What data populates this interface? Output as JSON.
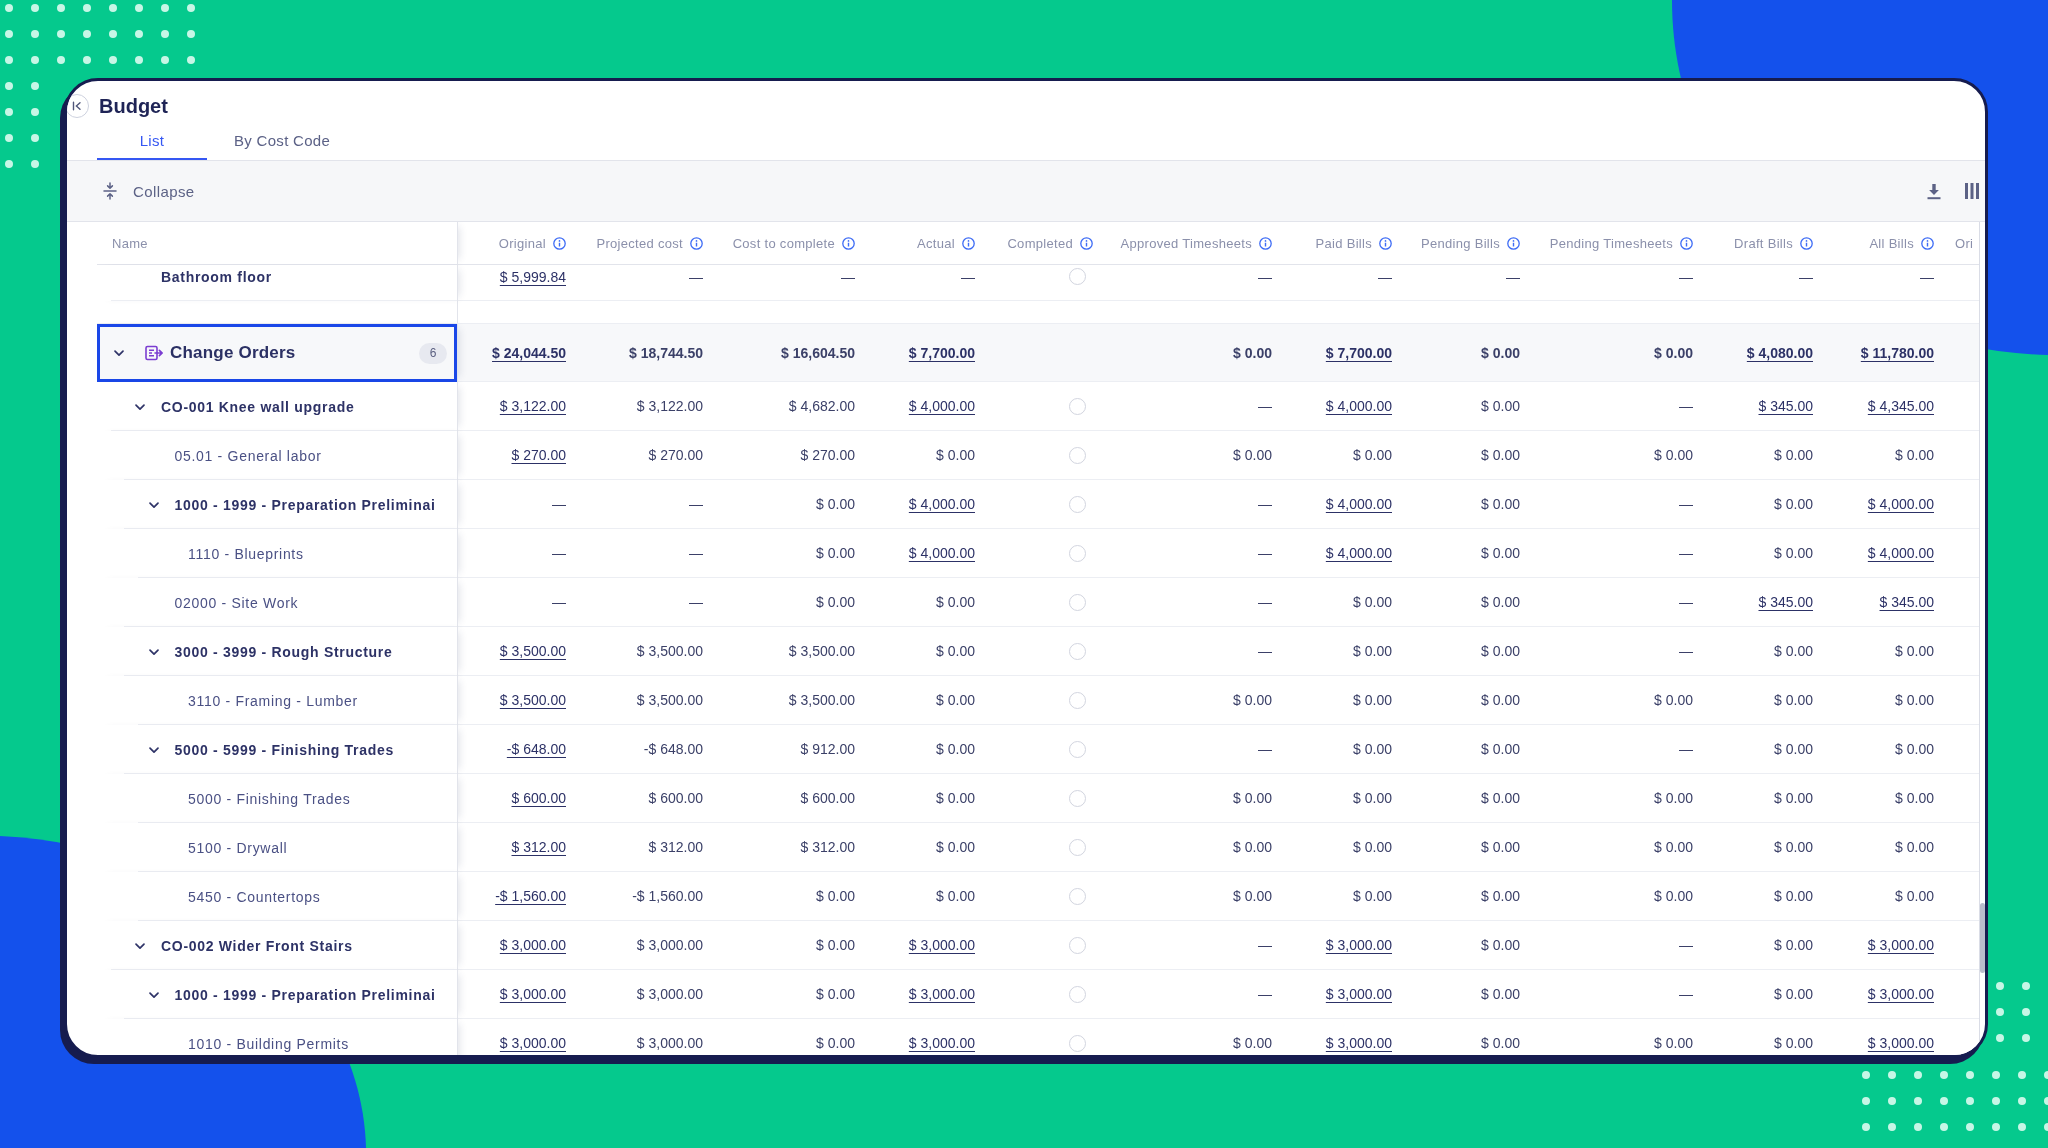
{
  "page": {
    "title": "Budget"
  },
  "tabs": [
    {
      "label": "List",
      "selected": true
    },
    {
      "label": "By Cost Code",
      "selected": false
    }
  ],
  "toolbar": {
    "collapse_button": "Collapse"
  },
  "table": {
    "columns": [
      {
        "label": "Name",
        "kind": "name",
        "info": false
      },
      {
        "label": "Original",
        "kind": "amount",
        "info": true
      },
      {
        "label": "Projected cost",
        "kind": "amount",
        "info": true
      },
      {
        "label": "Cost to complete",
        "kind": "amount",
        "info": true
      },
      {
        "label": "Actual",
        "kind": "amount",
        "info": true
      },
      {
        "label": "Completed",
        "kind": "status",
        "info": true
      },
      {
        "label": "Approved Timesheets",
        "kind": "amount",
        "info": true
      },
      {
        "label": "Paid Bills",
        "kind": "amount",
        "info": true
      },
      {
        "label": "Pending Bills",
        "kind": "amount",
        "info": true
      },
      {
        "label": "Pending Timesheets",
        "kind": "amount",
        "info": true
      },
      {
        "label": "Draft Bills",
        "kind": "amount",
        "info": true
      },
      {
        "label": "All Bills",
        "kind": "amount",
        "info": true
      },
      {
        "label": "Ori",
        "kind": "amount",
        "info": false
      }
    ],
    "groups": [
      {
        "rows": [
          {
            "kind": "group",
            "name": "Bathroom floor",
            "completed": false,
            "cells": [
              {
                "text": "$ 5,999.84",
                "link": true
              },
              {
                "text": "—",
                "link": false
              },
              {
                "text": "—",
                "link": false
              },
              {
                "text": "—",
                "link": false
              },
              {
                "text": "—",
                "link": false
              },
              {
                "text": "—",
                "link": false
              },
              {
                "text": "—",
                "link": false
              },
              {
                "text": "—",
                "link": false
              },
              {
                "text": "—",
                "link": false
              },
              {
                "text": "—",
                "link": false
              }
            ]
          }
        ]
      },
      {
        "name": "Change Orders",
        "badge": "6",
        "expanded": true,
        "selected": true,
        "cells": [
          {
            "text": "$ 24,044.50",
            "link": true
          },
          {
            "text": "$ 18,744.50",
            "link": false
          },
          {
            "text": "$ 16,604.50",
            "link": false
          },
          {
            "text": "$ 7,700.00",
            "link": true
          },
          {
            "text": "$ 0.00",
            "link": false
          },
          {
            "text": "$ 7,700.00",
            "link": true
          },
          {
            "text": "$ 0.00",
            "link": false
          },
          {
            "text": "$ 0.00",
            "link": false
          },
          {
            "text": "$ 4,080.00",
            "link": true
          },
          {
            "text": "$ 11,780.00",
            "link": true
          }
        ],
        "rows": [
          {
            "kind": "group",
            "name": "CO-001 Knee wall upgrade",
            "expanded": true,
            "completed": false,
            "cells": [
              {
                "text": "$ 3,122.00",
                "link": true
              },
              {
                "text": "$ 3,122.00",
                "link": false
              },
              {
                "text": "$ 4,682.00",
                "link": false
              },
              {
                "text": "$ 4,000.00",
                "link": true
              },
              {
                "text": "—",
                "link": false
              },
              {
                "text": "$ 4,000.00",
                "link": true
              },
              {
                "text": "$ 0.00",
                "link": false
              },
              {
                "text": "—",
                "link": false
              },
              {
                "text": "$ 345.00",
                "link": true
              },
              {
                "text": "$ 4,345.00",
                "link": true
              }
            ],
            "children": [
              {
                "kind": "item",
                "name": "05.01 - General labor",
                "completed": false,
                "cells": [
                  {
                    "text": "$ 270.00",
                    "link": true
                  },
                  {
                    "text": "$ 270.00",
                    "link": false
                  },
                  {
                    "text": "$ 270.00",
                    "link": false
                  },
                  {
                    "text": "$ 0.00",
                    "link": false
                  },
                  {
                    "text": "$ 0.00",
                    "link": false
                  },
                  {
                    "text": "$ 0.00",
                    "link": false
                  },
                  {
                    "text": "$ 0.00",
                    "link": false
                  },
                  {
                    "text": "$ 0.00",
                    "link": false
                  },
                  {
                    "text": "$ 0.00",
                    "link": false
                  },
                  {
                    "text": "$ 0.00",
                    "link": false
                  }
                ]
              },
              {
                "kind": "group",
                "name": "1000 - 1999 - Preparation Preliminai",
                "expanded": true,
                "completed": false,
                "cells": [
                  {
                    "text": "—",
                    "link": false
                  },
                  {
                    "text": "—",
                    "link": false
                  },
                  {
                    "text": "$ 0.00",
                    "link": false
                  },
                  {
                    "text": "$ 4,000.00",
                    "link": true
                  },
                  {
                    "text": "—",
                    "link": false
                  },
                  {
                    "text": "$ 4,000.00",
                    "link": true
                  },
                  {
                    "text": "$ 0.00",
                    "link": false
                  },
                  {
                    "text": "—",
                    "link": false
                  },
                  {
                    "text": "$ 0.00",
                    "link": false
                  },
                  {
                    "text": "$ 4,000.00",
                    "link": true
                  }
                ],
                "children": [
                  {
                    "kind": "item",
                    "name": "1110 - Blueprints",
                    "completed": false,
                    "cells": [
                      {
                        "text": "—",
                        "link": false
                      },
                      {
                        "text": "—",
                        "link": false
                      },
                      {
                        "text": "$ 0.00",
                        "link": false
                      },
                      {
                        "text": "$ 4,000.00",
                        "link": true
                      },
                      {
                        "text": "—",
                        "link": false
                      },
                      {
                        "text": "$ 4,000.00",
                        "link": true
                      },
                      {
                        "text": "$ 0.00",
                        "link": false
                      },
                      {
                        "text": "—",
                        "link": false
                      },
                      {
                        "text": "$ 0.00",
                        "link": false
                      },
                      {
                        "text": "$ 4,000.00",
                        "link": true
                      }
                    ]
                  }
                ]
              },
              {
                "kind": "item",
                "name": "02000 - Site Work",
                "completed": false,
                "cells": [
                  {
                    "text": "—",
                    "link": false
                  },
                  {
                    "text": "—",
                    "link": false
                  },
                  {
                    "text": "$ 0.00",
                    "link": false
                  },
                  {
                    "text": "$ 0.00",
                    "link": false
                  },
                  {
                    "text": "—",
                    "link": false
                  },
                  {
                    "text": "$ 0.00",
                    "link": false
                  },
                  {
                    "text": "$ 0.00",
                    "link": false
                  },
                  {
                    "text": "—",
                    "link": false
                  },
                  {
                    "text": "$ 345.00",
                    "link": true
                  },
                  {
                    "text": "$ 345.00",
                    "link": true
                  }
                ]
              },
              {
                "kind": "group",
                "name": "3000 - 3999 - Rough Structure",
                "expanded": true,
                "completed": false,
                "cells": [
                  {
                    "text": "$ 3,500.00",
                    "link": true
                  },
                  {
                    "text": "$ 3,500.00",
                    "link": false
                  },
                  {
                    "text": "$ 3,500.00",
                    "link": false
                  },
                  {
                    "text": "$ 0.00",
                    "link": false
                  },
                  {
                    "text": "—",
                    "link": false
                  },
                  {
                    "text": "$ 0.00",
                    "link": false
                  },
                  {
                    "text": "$ 0.00",
                    "link": false
                  },
                  {
                    "text": "—",
                    "link": false
                  },
                  {
                    "text": "$ 0.00",
                    "link": false
                  },
                  {
                    "text": "$ 0.00",
                    "link": false
                  }
                ],
                "children": [
                  {
                    "kind": "item",
                    "name": "3110 - Framing - Lumber",
                    "completed": false,
                    "cells": [
                      {
                        "text": "$ 3,500.00",
                        "link": true
                      },
                      {
                        "text": "$ 3,500.00",
                        "link": false
                      },
                      {
                        "text": "$ 3,500.00",
                        "link": false
                      },
                      {
                        "text": "$ 0.00",
                        "link": false
                      },
                      {
                        "text": "$ 0.00",
                        "link": false
                      },
                      {
                        "text": "$ 0.00",
                        "link": false
                      },
                      {
                        "text": "$ 0.00",
                        "link": false
                      },
                      {
                        "text": "$ 0.00",
                        "link": false
                      },
                      {
                        "text": "$ 0.00",
                        "link": false
                      },
                      {
                        "text": "$ 0.00",
                        "link": false
                      }
                    ]
                  }
                ]
              },
              {
                "kind": "group",
                "name": "5000 - 5999 - Finishing Trades",
                "expanded": true,
                "completed": false,
                "cells": [
                  {
                    "text": "-$ 648.00",
                    "link": true
                  },
                  {
                    "text": "-$ 648.00",
                    "link": false
                  },
                  {
                    "text": "$ 912.00",
                    "link": false
                  },
                  {
                    "text": "$ 0.00",
                    "link": false
                  },
                  {
                    "text": "—",
                    "link": false
                  },
                  {
                    "text": "$ 0.00",
                    "link": false
                  },
                  {
                    "text": "$ 0.00",
                    "link": false
                  },
                  {
                    "text": "—",
                    "link": false
                  },
                  {
                    "text": "$ 0.00",
                    "link": false
                  },
                  {
                    "text": "$ 0.00",
                    "link": false
                  }
                ],
                "children": [
                  {
                    "kind": "item",
                    "name": "5000 - Finishing Trades",
                    "completed": false,
                    "cells": [
                      {
                        "text": "$ 600.00",
                        "link": true
                      },
                      {
                        "text": "$ 600.00",
                        "link": false
                      },
                      {
                        "text": "$ 600.00",
                        "link": false
                      },
                      {
                        "text": "$ 0.00",
                        "link": false
                      },
                      {
                        "text": "$ 0.00",
                        "link": false
                      },
                      {
                        "text": "$ 0.00",
                        "link": false
                      },
                      {
                        "text": "$ 0.00",
                        "link": false
                      },
                      {
                        "text": "$ 0.00",
                        "link": false
                      },
                      {
                        "text": "$ 0.00",
                        "link": false
                      },
                      {
                        "text": "$ 0.00",
                        "link": false
                      }
                    ]
                  },
                  {
                    "kind": "item",
                    "name": "5100 - Drywall",
                    "completed": false,
                    "cells": [
                      {
                        "text": "$ 312.00",
                        "link": true
                      },
                      {
                        "text": "$ 312.00",
                        "link": false
                      },
                      {
                        "text": "$ 312.00",
                        "link": false
                      },
                      {
                        "text": "$ 0.00",
                        "link": false
                      },
                      {
                        "text": "$ 0.00",
                        "link": false
                      },
                      {
                        "text": "$ 0.00",
                        "link": false
                      },
                      {
                        "text": "$ 0.00",
                        "link": false
                      },
                      {
                        "text": "$ 0.00",
                        "link": false
                      },
                      {
                        "text": "$ 0.00",
                        "link": false
                      },
                      {
                        "text": "$ 0.00",
                        "link": false
                      }
                    ]
                  },
                  {
                    "kind": "item",
                    "name": "5450 - Countertops",
                    "completed": false,
                    "cells": [
                      {
                        "text": "-$ 1,560.00",
                        "link": true
                      },
                      {
                        "text": "-$ 1,560.00",
                        "link": false
                      },
                      {
                        "text": "$ 0.00",
                        "link": false
                      },
                      {
                        "text": "$ 0.00",
                        "link": false
                      },
                      {
                        "text": "$ 0.00",
                        "link": false
                      },
                      {
                        "text": "$ 0.00",
                        "link": false
                      },
                      {
                        "text": "$ 0.00",
                        "link": false
                      },
                      {
                        "text": "$ 0.00",
                        "link": false
                      },
                      {
                        "text": "$ 0.00",
                        "link": false
                      },
                      {
                        "text": "$ 0.00",
                        "link": false
                      }
                    ]
                  }
                ]
              }
            ]
          },
          {
            "kind": "group",
            "name": "CO-002 Wider Front Stairs",
            "expanded": true,
            "completed": false,
            "cells": [
              {
                "text": "$ 3,000.00",
                "link": true
              },
              {
                "text": "$ 3,000.00",
                "link": false
              },
              {
                "text": "$ 0.00",
                "link": false
              },
              {
                "text": "$ 3,000.00",
                "link": true
              },
              {
                "text": "—",
                "link": false
              },
              {
                "text": "$ 3,000.00",
                "link": true
              },
              {
                "text": "$ 0.00",
                "link": false
              },
              {
                "text": "—",
                "link": false
              },
              {
                "text": "$ 0.00",
                "link": false
              },
              {
                "text": "$ 3,000.00",
                "link": true
              }
            ],
            "children": [
              {
                "kind": "group",
                "name": "1000 - 1999 - Preparation Preliminai",
                "expanded": true,
                "completed": false,
                "cells": [
                  {
                    "text": "$ 3,000.00",
                    "link": true
                  },
                  {
                    "text": "$ 3,000.00",
                    "link": false
                  },
                  {
                    "text": "$ 0.00",
                    "link": false
                  },
                  {
                    "text": "$ 3,000.00",
                    "link": true
                  },
                  {
                    "text": "—",
                    "link": false
                  },
                  {
                    "text": "$ 3,000.00",
                    "link": true
                  },
                  {
                    "text": "$ 0.00",
                    "link": false
                  },
                  {
                    "text": "—",
                    "link": false
                  },
                  {
                    "text": "$ 0.00",
                    "link": false
                  },
                  {
                    "text": "$ 3,000.00",
                    "link": true
                  }
                ],
                "children": [
                  {
                    "kind": "item",
                    "name": "1010 - Building Permits",
                    "completed": false,
                    "cells": [
                      {
                        "text": "$ 3,000.00",
                        "link": true
                      },
                      {
                        "text": "$ 3,000.00",
                        "link": false
                      },
                      {
                        "text": "$ 0.00",
                        "link": false
                      },
                      {
                        "text": "$ 3,000.00",
                        "link": true
                      },
                      {
                        "text": "$ 0.00",
                        "link": false
                      },
                      {
                        "text": "$ 3,000.00",
                        "link": true
                      },
                      {
                        "text": "$ 0.00",
                        "link": false
                      },
                      {
                        "text": "$ 0.00",
                        "link": false
                      },
                      {
                        "text": "$ 0.00",
                        "link": false
                      },
                      {
                        "text": "$ 3,000.00",
                        "link": true
                      }
                    ]
                  }
                ]
              }
            ]
          }
        ]
      }
    ]
  }
}
